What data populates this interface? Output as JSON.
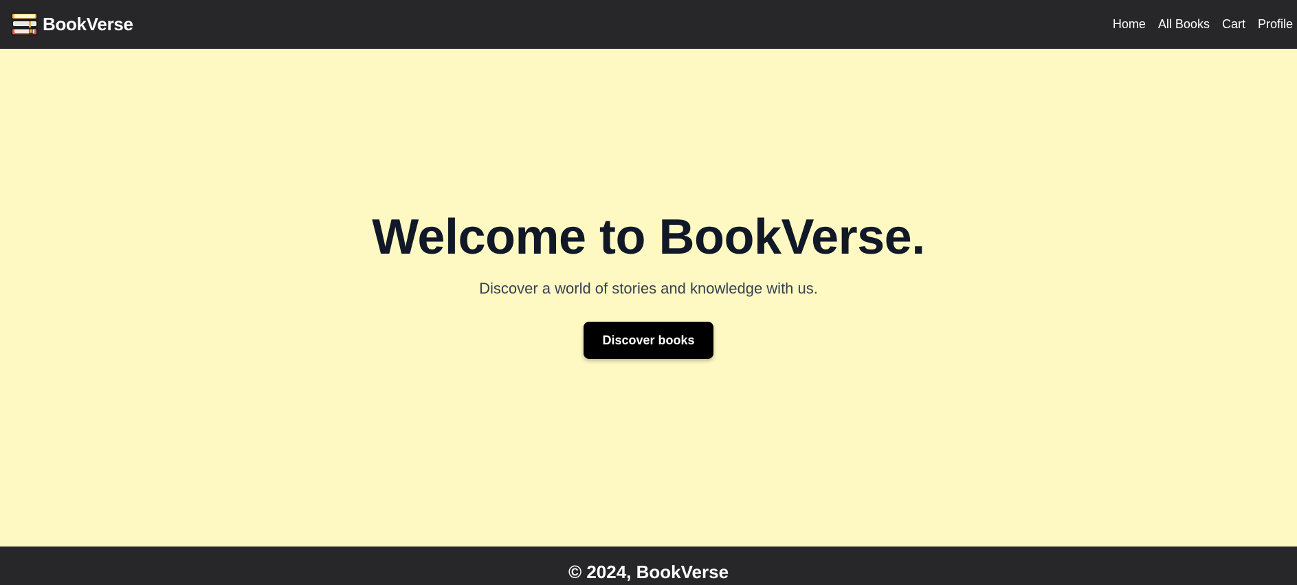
{
  "brand": {
    "name": "BookVerse",
    "logo_icon": "book-stack-icon"
  },
  "nav": {
    "links": [
      {
        "label": "Home"
      },
      {
        "label": "All Books"
      },
      {
        "label": "Cart"
      },
      {
        "label": "Profile"
      }
    ]
  },
  "hero": {
    "title": "Welcome to BookVerse.",
    "subtitle": "Discover a world of stories and knowledge with us.",
    "cta_label": "Discover books"
  },
  "footer": {
    "text": "© 2024, BookVerse"
  },
  "colors": {
    "nav_background": "#27272a",
    "hero_background": "#fef9c3",
    "title_color": "#111827",
    "button_background": "#000000"
  }
}
